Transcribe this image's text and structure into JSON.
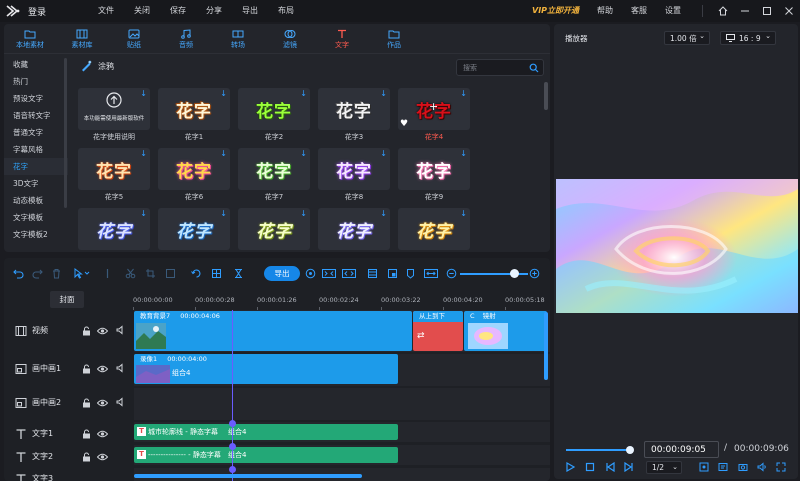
{
  "app": {
    "login": "登录",
    "menu": [
      "文件",
      "关闭",
      "保存",
      "分享",
      "导出",
      "布局"
    ],
    "vip": "VIP立即开通",
    "right_menu": [
      "帮助",
      "客服",
      "设置"
    ]
  },
  "resources": {
    "tabs": [
      "本地素材",
      "素材库",
      "贴纸",
      "音频",
      "转场",
      "滤镜",
      "文字",
      "作品"
    ],
    "active_tab": "文字",
    "categories": [
      "收藏",
      "热门",
      "预设文字",
      "语音转文字",
      "普通文字",
      "字幕风格",
      "花字",
      "3D文字",
      "动态模板",
      "文字模板",
      "文字模板2"
    ],
    "active_category": "花字",
    "breadcrumb": "涂鸦",
    "search_placeholder": "搜索",
    "info_tile_text": "本功能需使用最新版软件",
    "tile_glyph": "花字",
    "tiles": [
      "花字使用说明",
      "花字1",
      "花字2",
      "花字3",
      "花字4",
      "花字5",
      "花字6",
      "花字7",
      "花字8",
      "花字9"
    ],
    "selected_tile": "花字4"
  },
  "player": {
    "title": "播放器",
    "speed": "1.00 倍",
    "aspect": "16 : 9",
    "current_time": "00:00:09:05",
    "separator": "/",
    "total_time": "00:00:09:06",
    "page_ratio": "1/2"
  },
  "timeline": {
    "export_label": "导出",
    "cover_label": "封面",
    "ruler": [
      "00:00:00:00",
      "00:00:00:28",
      "00:00:01:26",
      "00:00:02:24",
      "00:00:03:22",
      "00:00:04:20",
      "00:00:05:18"
    ],
    "tracks": [
      "视频",
      "画中画1",
      "画中画2",
      "文字1",
      "文字2",
      "文字3"
    ],
    "clips": {
      "video1_title": "教育背景7",
      "video1_time": "00:00:04:06",
      "transition": "从上到下",
      "transition_extra": "C",
      "video2_title": "镜射",
      "pip_title": "录像1",
      "pip_time": "00:00:04:00",
      "pip_group": "组合4",
      "text1_label": "城市轮廓线 - 静态字幕",
      "text1_group": "组合4",
      "text2_label": "--------------- - 静态字幕",
      "text2_group": "组合4"
    }
  },
  "colors": {
    "accent_blue": "#1687e8",
    "accent_red": "#ff5a4f",
    "vip_gold": "#f2b33d",
    "clip_blue": "#1d9bea",
    "clip_green": "#23a877",
    "transition_red": "#e24d4d"
  }
}
